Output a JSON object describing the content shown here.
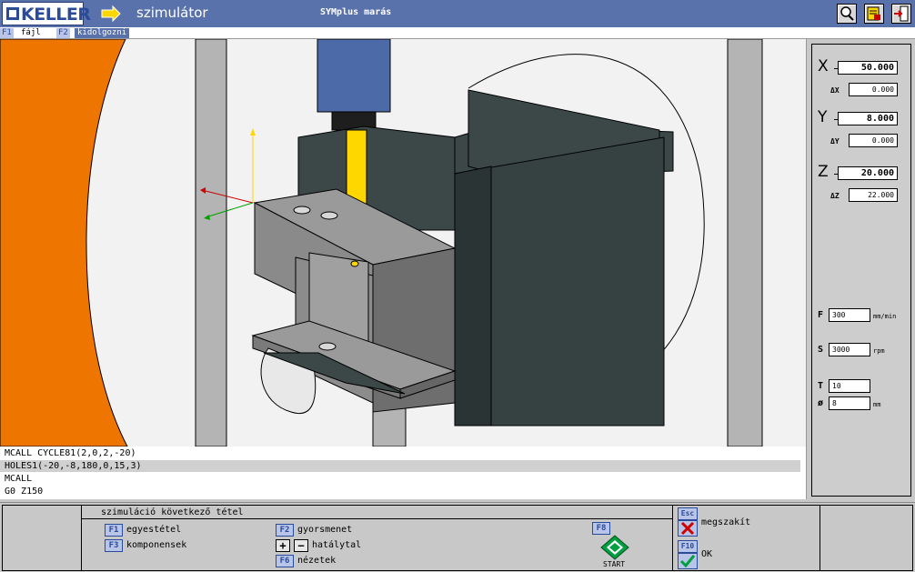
{
  "titlebar": {
    "logo": "KELLER",
    "mode": "szimulátor",
    "title": "SYMplus marás",
    "buttons": [
      "zoom-icon",
      "settings-icon",
      "exit-icon"
    ]
  },
  "menu": [
    {
      "key": "F1",
      "label": "fájl"
    },
    {
      "key": "F2",
      "label": "kidolgozni"
    }
  ],
  "coords": {
    "x": {
      "label": "X",
      "value": "50.000",
      "delta_label": "ΔX",
      "delta": "0.000"
    },
    "y": {
      "label": "Y",
      "value": "8.000",
      "delta_label": "ΔY",
      "delta": "0.000"
    },
    "z": {
      "label": "Z",
      "value": "20.000",
      "delta_label": "ΔZ",
      "delta": "22.000"
    }
  },
  "params": {
    "f": {
      "label": "F",
      "value": "300",
      "unit": "mm/min"
    },
    "s": {
      "label": "S",
      "value": "3000",
      "unit": "rpm"
    },
    "t": {
      "label": "T",
      "value": "10"
    },
    "d": {
      "label": "ø",
      "value": "8",
      "unit": "mm"
    }
  },
  "program": [
    "MCALL CYCLE81(2,0,2,-20)",
    "HOLES1(-20,-8,180,0,15,3)",
    "MCALL",
    "G0 Z150"
  ],
  "bottom": {
    "heading": "szimuláció következő tétel",
    "f1": {
      "key": "F1",
      "label": "egyestétel"
    },
    "f3": {
      "key": "F3",
      "label": "komponensek"
    },
    "f2": {
      "key": "F2",
      "label": "gyorsmenet"
    },
    "plus": "+",
    "minus": "−",
    "hataly": "hatálytal",
    "f6": {
      "key": "F6",
      "label": "nézetek"
    },
    "f8": {
      "key": "F8",
      "label": "START"
    },
    "esc": {
      "key": "Esc",
      "label": "megszakít"
    },
    "f10": {
      "key": "F10",
      "label": "OK"
    }
  },
  "colors": {
    "titlebar": "#5a72ac",
    "orange": "#ee7600",
    "tool_blue": "#4d6aa8",
    "drill": "#ffd700",
    "vise_dark": "#3c4848",
    "part_gray": "#8c8c8c"
  }
}
